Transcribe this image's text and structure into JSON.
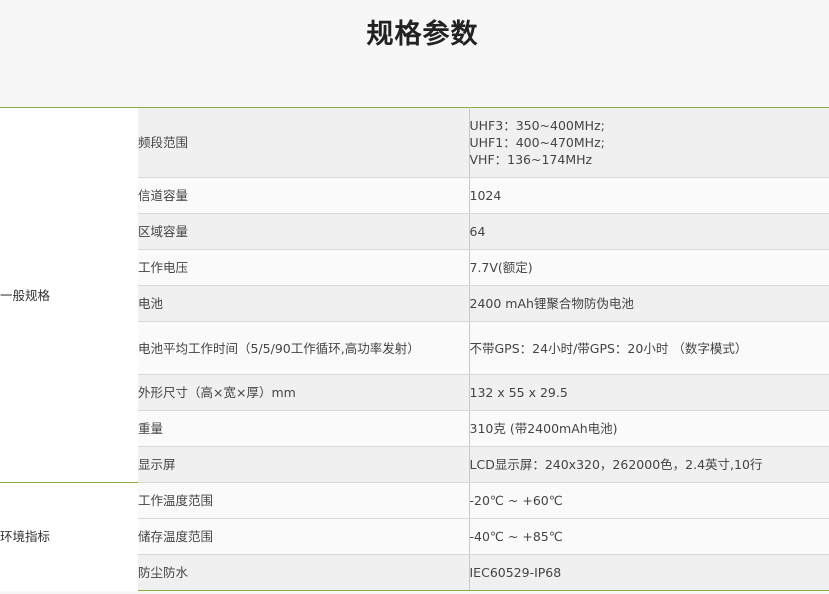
{
  "page": {
    "title": "规格参数"
  },
  "groups": [
    {
      "label": "一般规格",
      "rows": [
        {
          "name": "频段范围",
          "values": [
            "UHF3：350~400MHz;",
            "UHF1：400~470MHz;",
            "VHF：136~174MHz"
          ]
        },
        {
          "name": "信道容量",
          "values": [
            "1024"
          ]
        },
        {
          "name": "区域容量",
          "values": [
            "64"
          ]
        },
        {
          "name": "工作电压",
          "values": [
            "7.7V(额定)"
          ]
        },
        {
          "name": "电池",
          "values": [
            "2400 mAh锂聚合物防伪电池"
          ]
        },
        {
          "name": "电池平均工作时间（5/5/90工作循环,高功率发射）",
          "values": [
            "不带GPS：24小时/带GPS：20小时 （数字模式）"
          ]
        },
        {
          "name": "外形尺寸（高×宽×厚）mm",
          "values": [
            "132 x 55 x 29.5"
          ]
        },
        {
          "name": "重量",
          "values": [
            "310克 (带2400mAh电池)"
          ]
        },
        {
          "name": "显示屏",
          "values": [
            "LCD显示屏：240x320，262000色，2.4英寸,10行"
          ]
        }
      ]
    },
    {
      "label": "环境指标",
      "rows": [
        {
          "name": "工作温度范围",
          "values": [
            "-20℃ ~ +60℃"
          ]
        },
        {
          "name": "储存温度范围",
          "values": [
            "-40℃ ~ +85℃"
          ]
        },
        {
          "name": "防尘防水",
          "values": [
            "IEC60529-IP68"
          ]
        }
      ]
    }
  ],
  "colors": {
    "accent_rule": "#8aac3f",
    "row_alt": "#f0f0f0",
    "row_plain": "#fafafa",
    "group_cell": "#ffffff"
  }
}
